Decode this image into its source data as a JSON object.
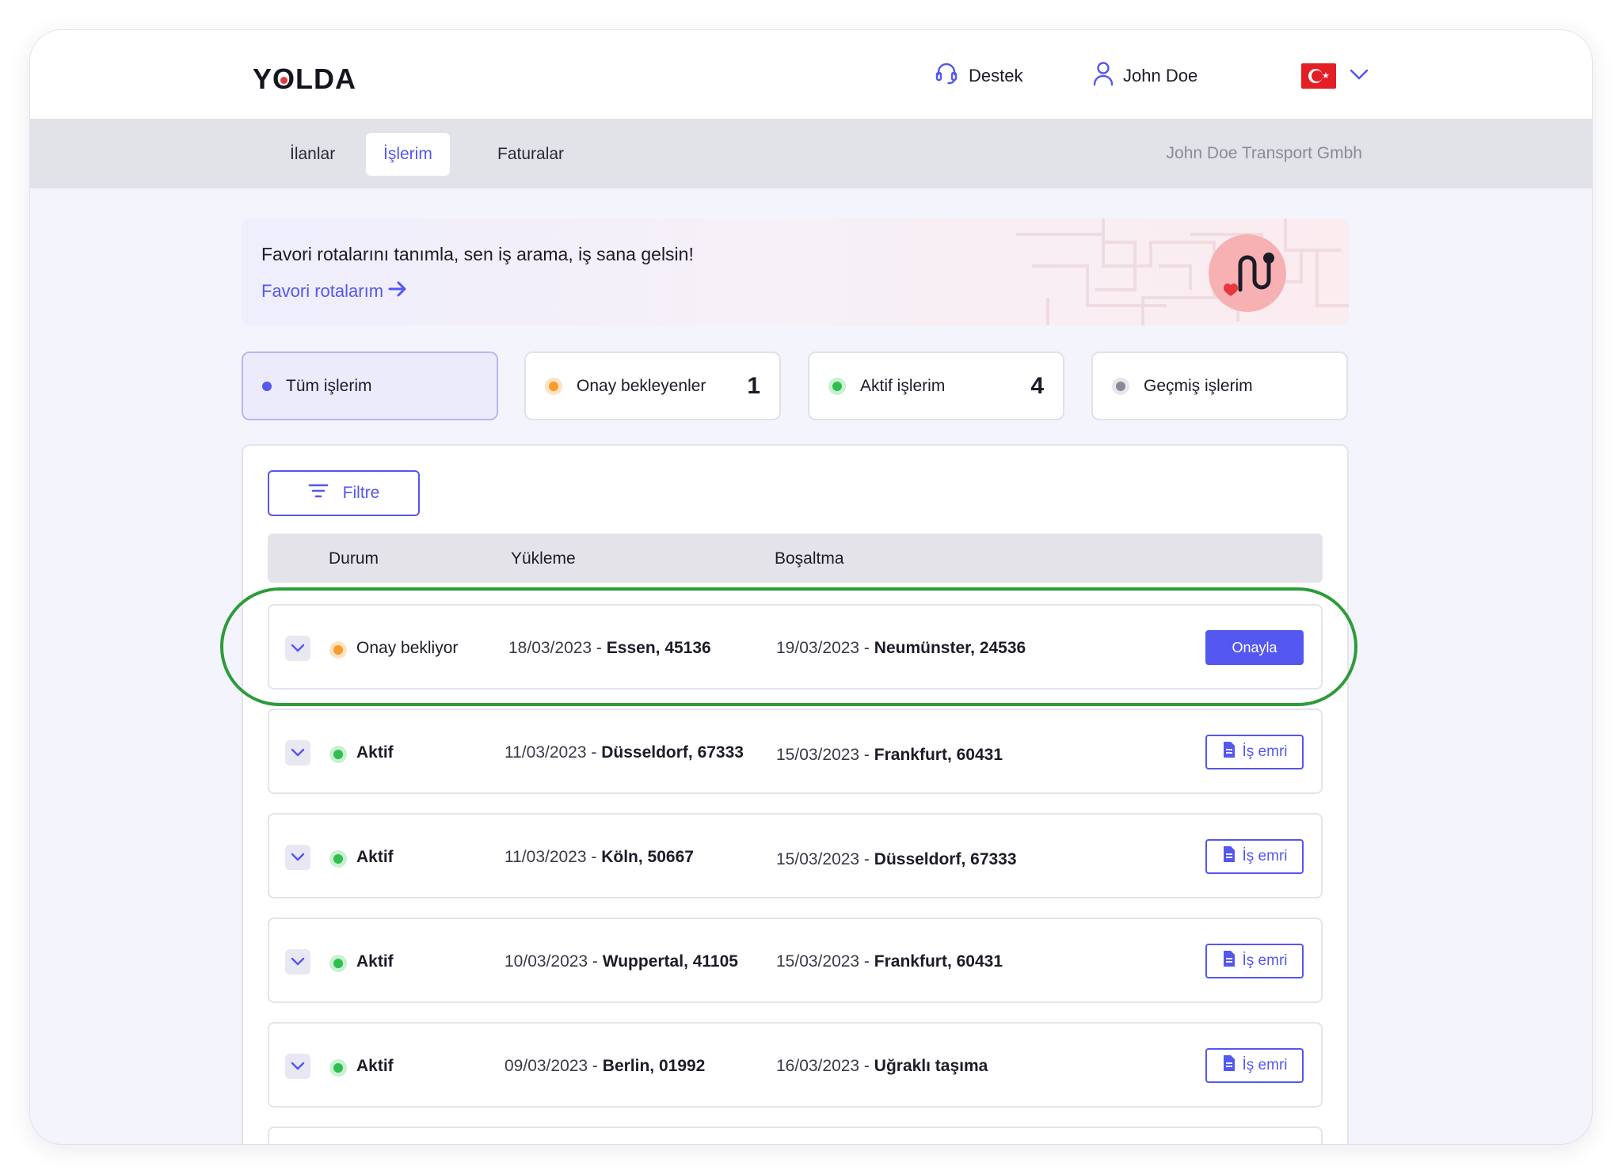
{
  "header": {
    "logo": "YOLDA",
    "support_label": "Destek",
    "user_name": "John Doe",
    "language_flag": "turkey-flag-icon"
  },
  "nav": {
    "tabs": [
      {
        "label": "İlanlar",
        "active": false
      },
      {
        "label": "İşlerim",
        "active": true
      },
      {
        "label": "Faturalar",
        "active": false
      }
    ],
    "company": "John Doe Transport Gmbh"
  },
  "banner": {
    "title": "Favori rotalarını tanımla, sen iş arama, iş sana gelsin!",
    "link_label": "Favori rotalarım"
  },
  "status_cards": [
    {
      "label": "Tüm işlerim",
      "count": "",
      "color": "#5457f0",
      "selected": true
    },
    {
      "label": "Onay bekleyenler",
      "count": "1",
      "color": "#f59c2a",
      "selected": false
    },
    {
      "label": "Aktif işlerim",
      "count": "4",
      "color": "#2fbf4f",
      "selected": false
    },
    {
      "label": "Geçmiş işlerim",
      "count": "",
      "color": "#8a8a94",
      "selected": false
    }
  ],
  "filter_label": "Filtre",
  "table": {
    "headers": {
      "status": "Durum",
      "loading": "Yükleme",
      "unloading": "Boşaltma"
    },
    "rows": [
      {
        "status": "Onay bekliyor",
        "status_color": "#f59c2a",
        "load_date": "18/03/2023 -",
        "load_place": "Essen, 45136",
        "unload_date": "19/03/2023 -",
        "unload_place": "Neumünster, 24536",
        "action": "Onayla"
      },
      {
        "status": "Aktif",
        "status_color": "#2fbf4f",
        "load_date": "11/03/2023 -",
        "load_place": "Düsseldorf, 67333",
        "unload_date": "15/03/2023 -",
        "unload_place": "Frankfurt, 60431",
        "action": "İş emri"
      },
      {
        "status": "Aktif",
        "status_color": "#2fbf4f",
        "load_date": "11/03/2023 -",
        "load_place": "Köln, 50667",
        "unload_date": "15/03/2023 -",
        "unload_place": "Düsseldorf, 67333",
        "action": "İş emri"
      },
      {
        "status": "Aktif",
        "status_color": "#2fbf4f",
        "load_date": "10/03/2023 -",
        "load_place": "Wuppertal, 41105",
        "unload_date": "15/03/2023 -",
        "unload_place": "Frankfurt, 60431",
        "action": "İş emri"
      },
      {
        "status": "Aktif",
        "status_color": "#2fbf4f",
        "load_date": "09/03/2023 -",
        "load_place": "Berlin, 01992",
        "unload_date": "16/03/2023 -",
        "unload_place": "Uğraklı taşıma",
        "action": "İş emri"
      }
    ]
  },
  "colors": {
    "accent": "#5457f0",
    "highlight": "#2e9b3a"
  }
}
